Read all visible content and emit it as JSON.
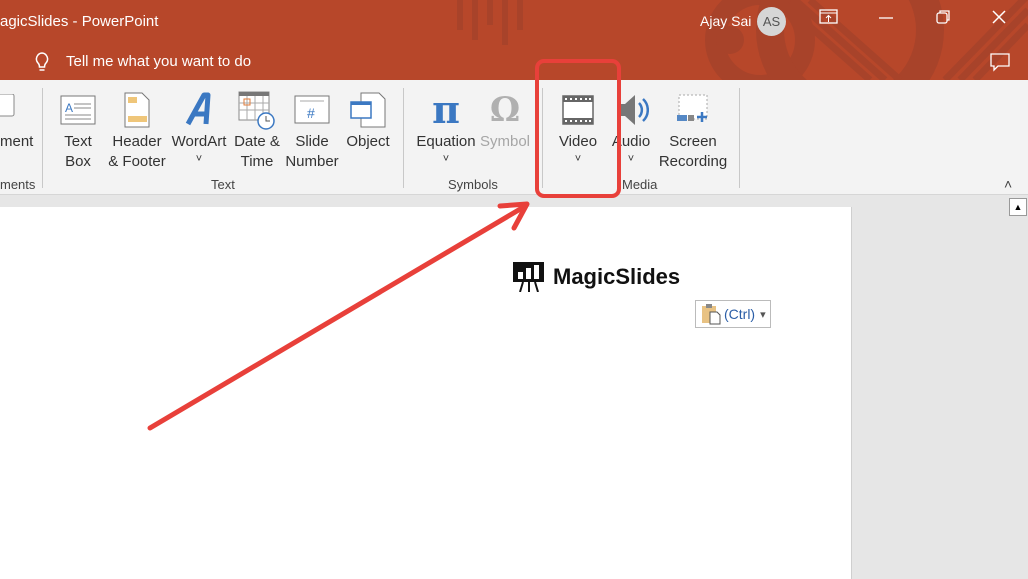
{
  "titlebar": {
    "title": "agicSlides  -  PowerPoint",
    "tell_me": "Tell me what you want to do",
    "user_name": "Ajay Sai",
    "avatar_initials": "AS"
  },
  "ribbon": {
    "partial_item": "ment",
    "partial_group": "ments",
    "text_group": {
      "label": "Text",
      "items": [
        {
          "label1": "Text",
          "label2": "Box"
        },
        {
          "label1": "Header",
          "label2": "& Footer"
        },
        {
          "label1": "WordArt",
          "chev": "˅"
        },
        {
          "label1": "Date &",
          "label2": "Time"
        },
        {
          "label1": "Slide",
          "label2": "Number"
        },
        {
          "label1": "Object"
        }
      ]
    },
    "symbols_group": {
      "label": "Symbols",
      "equation": "Equation",
      "symbol": "Symbol",
      "chev": "˅"
    },
    "media_group": {
      "label": "Media",
      "video": "Video",
      "audio": "Audio",
      "screen1": "Screen",
      "screen2": "Recording",
      "chev": "˅"
    },
    "collapse": "˄"
  },
  "slide": {
    "logo_text": "MagicSlides",
    "paste_label": "(Ctrl)",
    "paste_caret": "▾"
  },
  "scrollbar": {
    "up": "▲"
  },
  "colors": {
    "brand": "#b7472a",
    "annotation": "#e8403a"
  }
}
